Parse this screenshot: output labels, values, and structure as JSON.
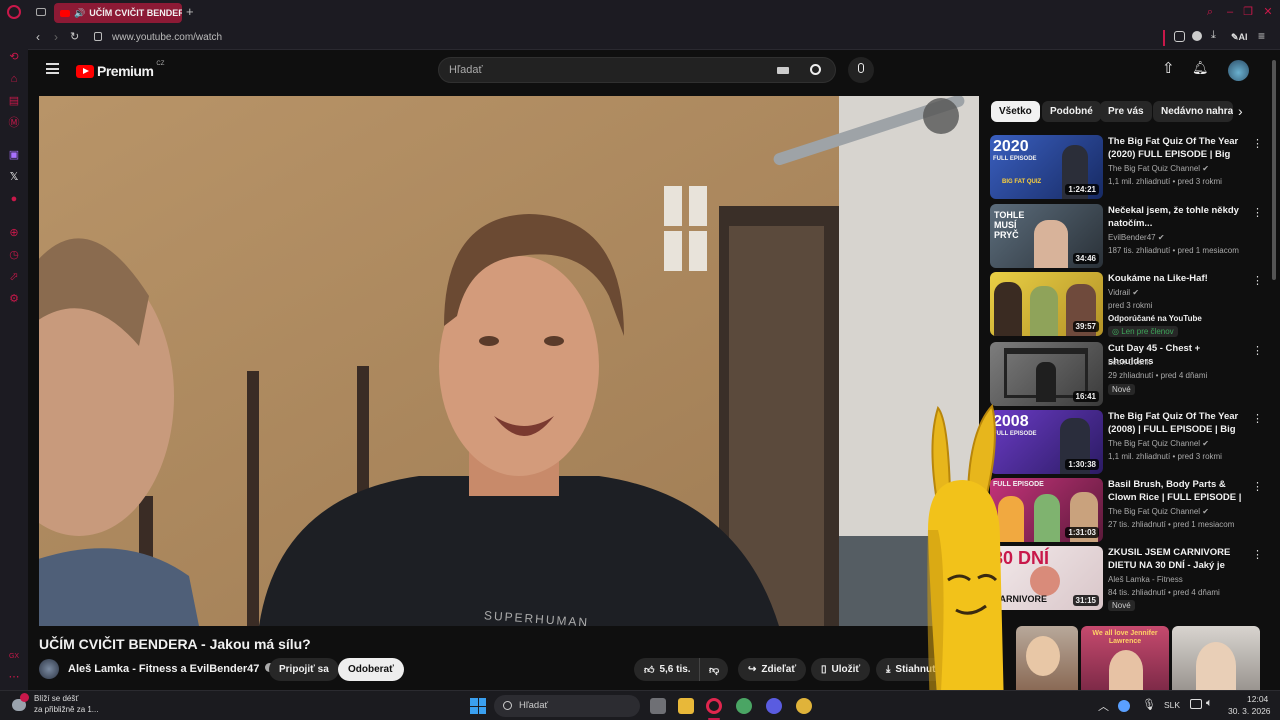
{
  "browser": {
    "tab_title": "UČÍM CVIČIT BENDERA",
    "url": "www.youtube.com/watch",
    "ai_label": "AI"
  },
  "yt": {
    "logo": "Premium",
    "region": "CZ",
    "search_placeholder": "Hľadať",
    "chips": [
      "Všetko",
      "Podobné",
      "Pre vás",
      "Nedávno nahrané"
    ],
    "video_title": "UČÍM CVIČIT BENDERA - Jakou má sílu?",
    "shirt_text": "SUPERHUMAN",
    "channel": "Aleš Lamka - Fitness a EvilBender47",
    "join": "Pripojiť sa",
    "subscribe": "Odoberať",
    "likes": "5,6 tis.",
    "share": "Zdieľať",
    "save": "Uložiť",
    "download": "Stiahnuť"
  },
  "recs": [
    {
      "title": "The Big Fat Quiz Of The Year (2020) FULL EPISODE | Big Fat...",
      "channel": "The Big Fat Quiz Channel",
      "meta": "1,1 mil. zhliadnutí • pred 3 rokmi",
      "duration": "1:24:21",
      "verified": true
    },
    {
      "title": "Nečekal jsem, že tohle někdy natočím...",
      "channel": "EvilBender47",
      "meta": "187 tis. zhliadnutí • pred 1 mesiacom",
      "duration": "34:46",
      "verified": true
    },
    {
      "title": "Koukáme na Like-Haf!",
      "channel": "Vidrail",
      "meta": "pred 3 rokmi",
      "extra": "Odporúčané na YouTube",
      "badge": "Len pre členov",
      "duration": "39:57",
      "verified": true
    },
    {
      "title": "Cut Day 45 - Chest + shoulders",
      "channel": "Leon Cvenk",
      "meta": "29 zhliadnutí • pred 4 dňami",
      "badge": "Nové",
      "duration": "16:41",
      "verified": false
    },
    {
      "title": "The Big Fat Quiz Of The Year (2008) | FULL EPISODE | Big F...",
      "channel": "The Big Fat Quiz Channel",
      "meta": "1,1 mil. zhliadnutí • pred 3 rokmi",
      "duration": "1:30:38",
      "verified": true
    },
    {
      "title": "Basil Brush, Body Parts & Clown Rice | FULL EPISODE | Big Fat ...",
      "channel": "The Big Fat Quiz Channel",
      "meta": "27 tis. zhliadnutí • pred 1 mesiacom",
      "duration": "1:31:03",
      "verified": true
    },
    {
      "title": "ZKUSIL JSEM CARNIVORE DIETU NA 30 DNÍ - Jaký je můj...",
      "channel": "Aleš Lamka - Fitness",
      "meta": "84 tis. zhliadnutí • pred 4 dňami",
      "badge": "Nové",
      "duration": "31:15",
      "verified": false
    }
  ],
  "thumb_texts": {
    "t1_year": "2020",
    "t1_sub": "FULL EPISODE",
    "t1_logo": "BIG FAT QUIZ",
    "t2_text": "TOHLE MUSÍ PRYČ",
    "t5_year": "2008",
    "t5_sub": "FULL EPISODE",
    "t6_sub": "FULL EPISODE",
    "t7_text": "30 DNÍ",
    "t7_sub": "CARNIVORE",
    "shorts_text": "We all love Jennifer Lawrence"
  },
  "taskbar": {
    "weather_title": "Blíží se déšť",
    "weather_sub": "za přibližně za 1...",
    "search": "Hľadať",
    "lang": "SLK",
    "time": "12:04",
    "date": "30. 3. 2026"
  },
  "colors": {
    "opera_red": "#c8184a",
    "yt_red": "#ff0000",
    "tab_bg": "#8c1a35"
  }
}
